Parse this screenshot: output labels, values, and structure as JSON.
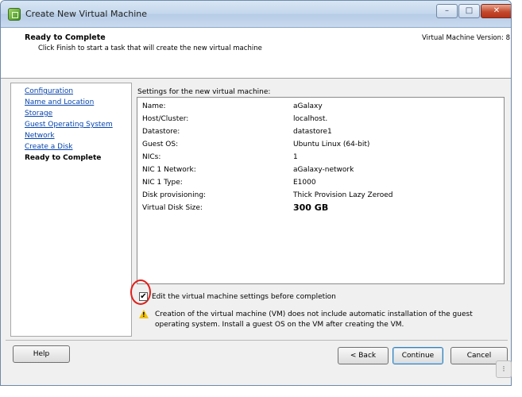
{
  "window": {
    "title": "Create New Virtual Machine",
    "buttons": {
      "minimize": "–",
      "maximize": "□",
      "close": "✕"
    }
  },
  "header": {
    "title": "Ready to Complete",
    "description": "Click Finish to start a task that will create the new virtual machine",
    "version": "Virtual Machine Version: 8"
  },
  "nav": {
    "items": [
      {
        "label": "Configuration",
        "current": false
      },
      {
        "label": "Name and Location",
        "current": false
      },
      {
        "label": "Storage",
        "current": false
      },
      {
        "label": "Guest Operating System",
        "current": false
      },
      {
        "label": "Network",
        "current": false
      },
      {
        "label": "Create a Disk",
        "current": false
      },
      {
        "label": "Ready to Complete",
        "current": true
      }
    ]
  },
  "settings": {
    "label": "Settings for the new virtual machine:",
    "rows": [
      {
        "label": "Name:",
        "value": "aGalaxy"
      },
      {
        "label": "Host/Cluster:",
        "value": "localhost."
      },
      {
        "label": "Datastore:",
        "value": "datastore1"
      },
      {
        "label": "Guest OS:",
        "value": "Ubuntu Linux (64-bit)"
      },
      {
        "label": "NICs:",
        "value": "1"
      },
      {
        "label": "NIC 1 Network:",
        "value": "aGalaxy-network"
      },
      {
        "label": "NIC 1 Type:",
        "value": "E1000"
      },
      {
        "label": "Disk provisioning:",
        "value": "Thick Provision Lazy Zeroed"
      },
      {
        "label": "Virtual Disk Size:",
        "value": "300 GB"
      }
    ]
  },
  "edit_option": {
    "label": "Edit the virtual machine settings before completion",
    "checked": true,
    "check_glyph": "✔"
  },
  "warning": {
    "icon": "warning-icon",
    "text": "Creation of the virtual machine (VM) does not include automatic installation of the guest operating system. Install a guest OS on the VM after creating the VM."
  },
  "footer": {
    "help": "Help",
    "back": "< Back",
    "continue": "Continue",
    "cancel": "Cancel"
  },
  "colors": {
    "link": "#0645ad",
    "highlight_ring": "#e0201a",
    "warning": "#f2c200"
  }
}
